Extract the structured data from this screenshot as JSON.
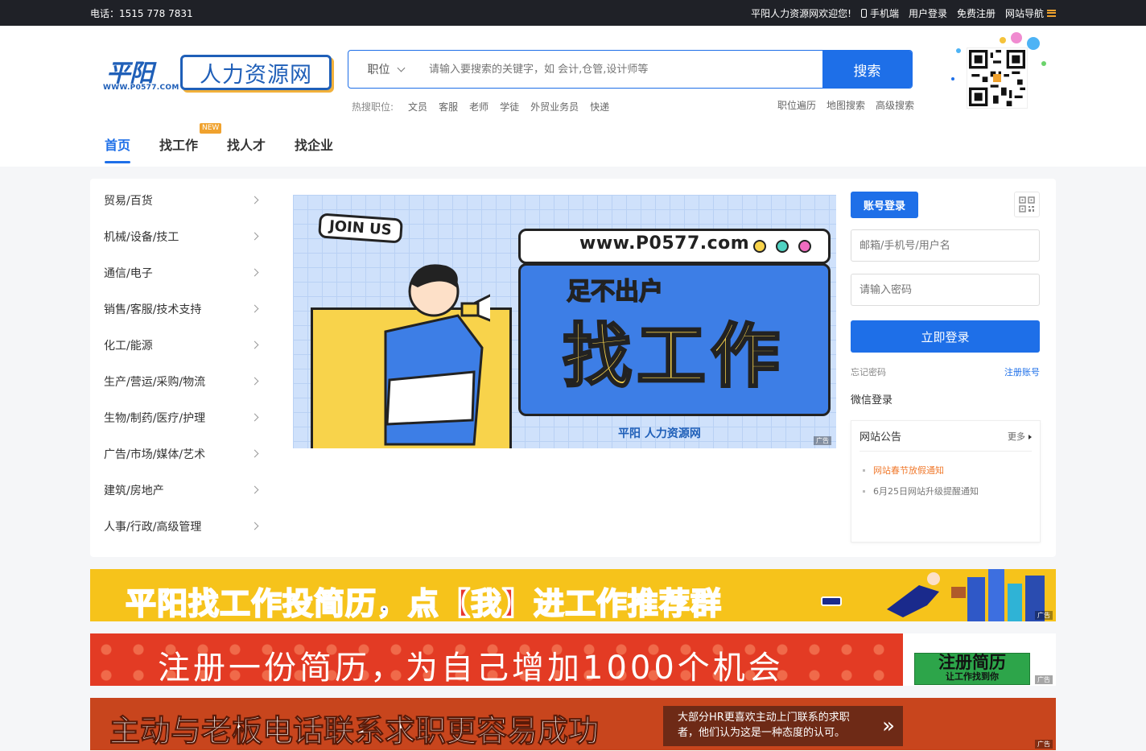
{
  "topbar": {
    "phone": "电话：1515 778 7831",
    "welcome": "平阳人力资源网欢迎您!",
    "mobile": "手机端",
    "user_login": "用户登录",
    "free_register": "免费注册",
    "site_nav": "网站导航"
  },
  "logo": {
    "ping": "平阳",
    "site": "WWW.P0577.COM",
    "name": "人力资源网"
  },
  "search": {
    "category": "职位",
    "placeholder": "请输入要搜索的关键字，如 会计,仓管,设计师等",
    "button": "搜索"
  },
  "hot": {
    "label": "热搜职位:",
    "items": [
      "文员",
      "客服",
      "老师",
      "学徒",
      "外贸业务员",
      "快递"
    ]
  },
  "quick_links": [
    "职位遍历",
    "地图搜索",
    "高级搜索"
  ],
  "nav": {
    "items": [
      "首页",
      "找工作",
      "找人才",
      "找企业"
    ],
    "new_badge": "NEW"
  },
  "categories": [
    "贸易/百货",
    "机械/设备/技工",
    "通信/电子",
    "销售/客服/技术支持",
    "化工/能源",
    "生产/营运/采购/物流",
    "生物/制药/医疗/护理",
    "广告/市场/媒体/艺术",
    "建筑/房地产",
    "人事/行政/高级管理"
  ],
  "banner": {
    "join": "JOIN US",
    "url": "www.P0577.com",
    "subtitle": "足不出户",
    "headline": "找工作",
    "brand": "平阳 人力资源网",
    "ad": "广告"
  },
  "login": {
    "tab": "账号登录",
    "username_placeholder": "邮箱/手机号/用户名",
    "password_placeholder": "请输入密码",
    "submit": "立即登录",
    "forgot": "忘记密码",
    "register": "注册账号",
    "wechat": "微信登录"
  },
  "notice": {
    "title": "网站公告",
    "more": "更多",
    "items": [
      "网站春节放假通知",
      "6月25日网站升级提醒通知"
    ]
  },
  "ads": {
    "strip1_a": "平阳找工作投简历，点",
    "strip1_b": "【我】",
    "strip1_c": "进工作推荐群",
    "strip2": "注册一份简历，为自己增加1000个机会",
    "strip2_badge": "注册简历",
    "strip2_badge_sub": "让工作找到你",
    "strip3": "主动与老板电话联系求职更容易成功",
    "strip3_box": "大部分HR更喜欢主动上门联系的求职者，他们认为这是一种态度的认可。",
    "ad_label": "广告"
  },
  "colors": {
    "primary": "#1e6fe8",
    "topbar": "#1f2127",
    "accent": "#f0a22e",
    "notice_highlight": "#f07a2e"
  }
}
